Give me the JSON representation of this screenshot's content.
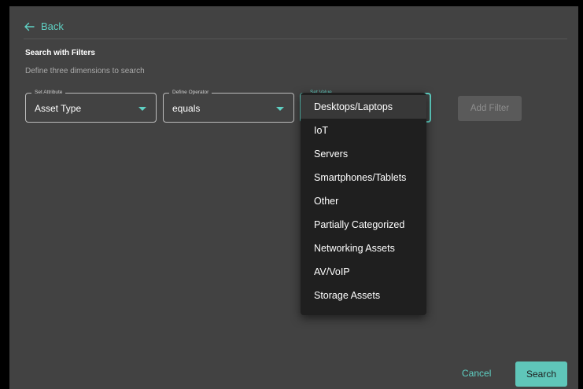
{
  "header": {
    "back_label": "Back"
  },
  "form": {
    "title": "Search with Filters",
    "subtitle": "Define three dimensions to search",
    "attribute": {
      "legend": "Set Attribute",
      "value": "Asset Type"
    },
    "operator": {
      "legend": "Define Operator",
      "value": "equals"
    },
    "set_value": {
      "legend": "Set Value",
      "value": ""
    },
    "add_filter_label": "Add Filter"
  },
  "dropdown": {
    "selected_index": 0,
    "options": [
      "Desktops/Laptops",
      "IoT",
      "Servers",
      "Smartphones/Tablets",
      "Other",
      "Partially Categorized",
      "Networking Assets",
      "AV/VoIP",
      "Storage Assets"
    ]
  },
  "footer": {
    "cancel_label": "Cancel",
    "search_label": "Search"
  },
  "colors": {
    "accent": "#5fd1c4",
    "panel": "#424242",
    "menu": "#1f1f1f",
    "button": "#5fc6b9"
  }
}
